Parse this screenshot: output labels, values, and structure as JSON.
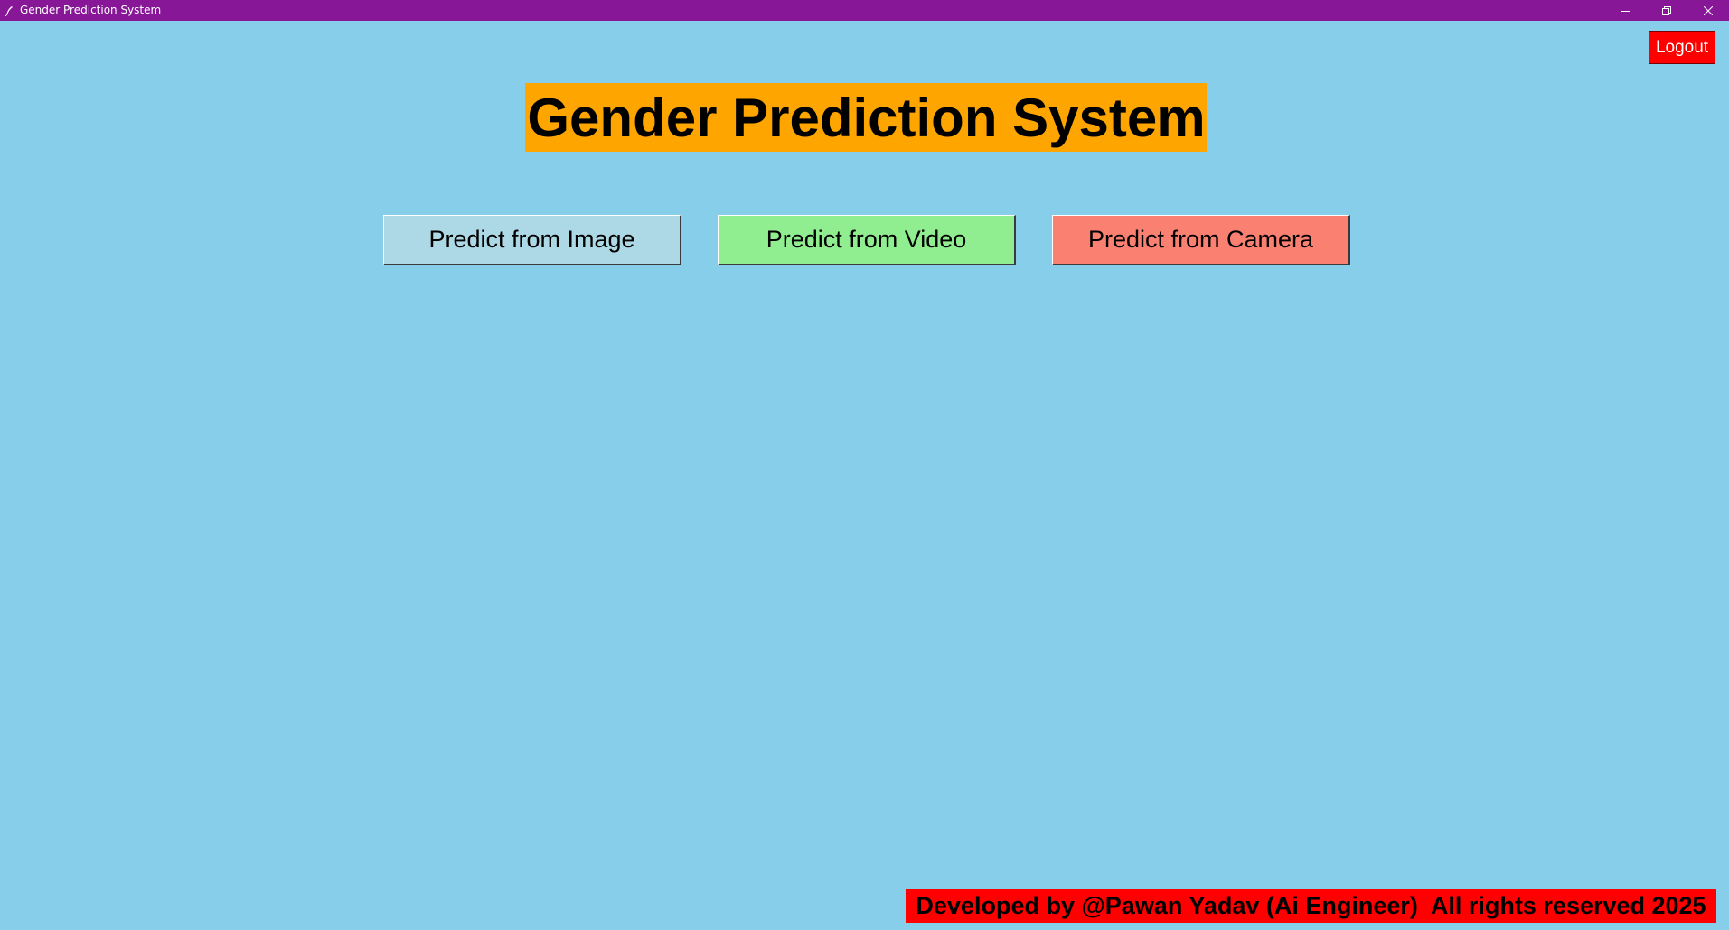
{
  "window": {
    "title": "Gender Prediction System",
    "titlebar_color": "#881798",
    "background_color": "#87CEEB",
    "controls": [
      "minimize-icon",
      "restore-icon",
      "close-icon"
    ]
  },
  "header": {
    "logout_label": "Logout",
    "logout_color": "#FF0000"
  },
  "main": {
    "heading": "Gender Prediction System",
    "heading_bg": "#FFA500",
    "buttons": [
      {
        "label": "Predict from Image",
        "color": "#ADD8E6"
      },
      {
        "label": "Predict from Video",
        "color": "#90EE90"
      },
      {
        "label": "Predict from Camera",
        "color": "#FA8072"
      }
    ]
  },
  "footer": {
    "text": "Developed by @Pawan Yadav (Ai Engineer)  All rights reserved 2025",
    "bg": "#FF0000"
  }
}
